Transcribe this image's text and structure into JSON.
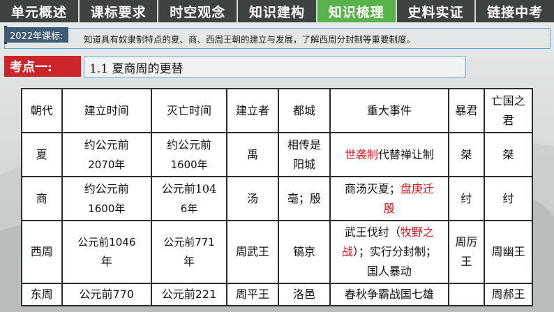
{
  "nav": {
    "tabs": [
      "单元概述",
      "课标要求",
      "时空观念",
      "知识建构",
      "知识梳理",
      "史料实证",
      "链接中考"
    ],
    "active_index": 4,
    "active_color": "#58b34b"
  },
  "standard": {
    "label": "2022年课标:",
    "text": "知道具有奴隶制特点的夏、商、西周王朝的建立与发展，了解西周分封制等重要制度。"
  },
  "keypoint": {
    "label": "考点一:",
    "title": "1.1  夏商周的更替"
  },
  "table": {
    "headers": [
      "朝代",
      "建立时间",
      "灭亡时间",
      "建立者",
      "都城",
      "重大事件",
      "暴君",
      "亡国之君"
    ],
    "rows": [
      {
        "dynasty": "夏",
        "start_a": "约公元前",
        "start_b": "2070年",
        "end_a": "约公元前",
        "end_b": "1600年",
        "founder": "禹",
        "capital_a": "相传是",
        "capital_b": "阳城",
        "event_red": "世袭制",
        "event_rest": "代替禅让制",
        "tyrant": "桀",
        "last_ruler": "桀"
      },
      {
        "dynasty": "商",
        "start_a": "约公元前",
        "start_b": "1600年",
        "end_a": "公元前104",
        "end_b": "6年",
        "founder": "汤",
        "capital": "亳；殷",
        "event_a": "商汤灭夏；",
        "event_red_a": "盘庚迁",
        "event_red_b": "殷",
        "tyrant": "纣",
        "last_ruler": "纣"
      },
      {
        "dynasty": "西周",
        "start_a": "公元前1046",
        "start_b": "年",
        "end_a": "公元前771",
        "end_b": "年",
        "founder": "周武王",
        "capital": "镐京",
        "event_a": "武王伐纣（",
        "event_red_a": "牧野之",
        "event_red_b": "战",
        "event_b": "）；实行分封制；",
        "event_c": "国人暴动",
        "tyrant_a": "周厉",
        "tyrant_b": "王",
        "last_ruler": "周幽王"
      },
      {
        "dynasty": "东周",
        "start": "公元前770",
        "end": "公元前221",
        "founder": "周平王",
        "capital": "洛邑",
        "event": "春秋争霸战国七雄",
        "tyrant": "",
        "last_ruler": "周郝王"
      }
    ]
  }
}
